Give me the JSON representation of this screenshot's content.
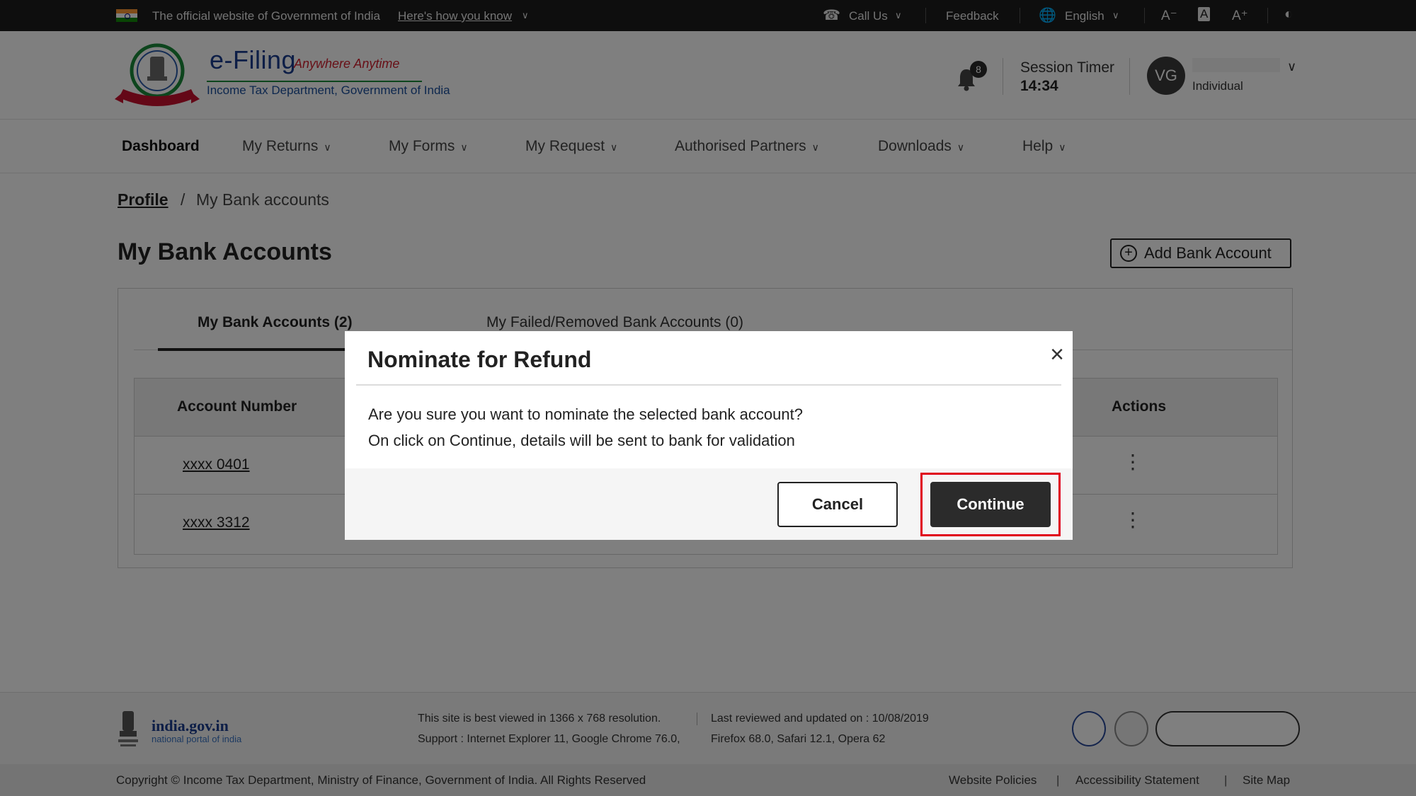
{
  "gov_bar": {
    "official_text": "The official website of Government of India",
    "know_link": "Here's how you know",
    "call_us": "Call Us",
    "feedback": "Feedback",
    "language": "English"
  },
  "header": {
    "logo_title": "e-Filing",
    "logo_tagline": "Anywhere Anytime",
    "logo_subtitle": "Income Tax Department, Government of India",
    "notification_count": "8",
    "session_label": "Session Timer",
    "session_time": "14:34",
    "avatar_initials": "VG",
    "user_type": "Individual"
  },
  "nav": {
    "items": [
      {
        "label": "Dashboard"
      },
      {
        "label": "My Returns"
      },
      {
        "label": "My Forms"
      },
      {
        "label": "My Request"
      },
      {
        "label": "Authorised Partners"
      },
      {
        "label": "Downloads"
      },
      {
        "label": "Help"
      }
    ]
  },
  "breadcrumb": {
    "parent": "Profile",
    "separator": "/",
    "current": "My Bank accounts"
  },
  "page": {
    "title": "My Bank Accounts",
    "add_button": "Add Bank Account",
    "tabs": [
      {
        "label": "My Bank Accounts (2)"
      },
      {
        "label": "My Failed/Removed Bank Accounts (0)"
      }
    ],
    "table": {
      "headers": {
        "account_number": "Account Number",
        "actions": "Actions"
      },
      "rows": [
        {
          "account_number": "xxxx 0401"
        },
        {
          "account_number": "xxxx 3312"
        }
      ]
    }
  },
  "footer": {
    "portal_name": "india.gov.in",
    "portal_sub": "national portal of india",
    "resolution_note": "This site is best viewed in 1366 x 768 resolution.",
    "last_reviewed": "Last reviewed and updated on : 10/08/2019",
    "support_note": "Support : Internet Explorer 11, Google Chrome 76.0,",
    "support_note_b": "Firefox 68.0, Safari 12.1, Opera 62",
    "copyright": "Copyright © Income Tax Department, Ministry of Finance, Government of India. All Rights Reserved",
    "links": [
      "Website Policies",
      "Accessibility Statement",
      "Site Map"
    ]
  },
  "modal": {
    "title": "Nominate for Refund",
    "message_line1": "Are you sure you want to nominate the selected bank account?",
    "message_line2": "On click on Continue, details will be sent to bank for validation",
    "cancel_label": "Cancel",
    "continue_label": "Continue",
    "highlight_color": "#e0001b"
  }
}
